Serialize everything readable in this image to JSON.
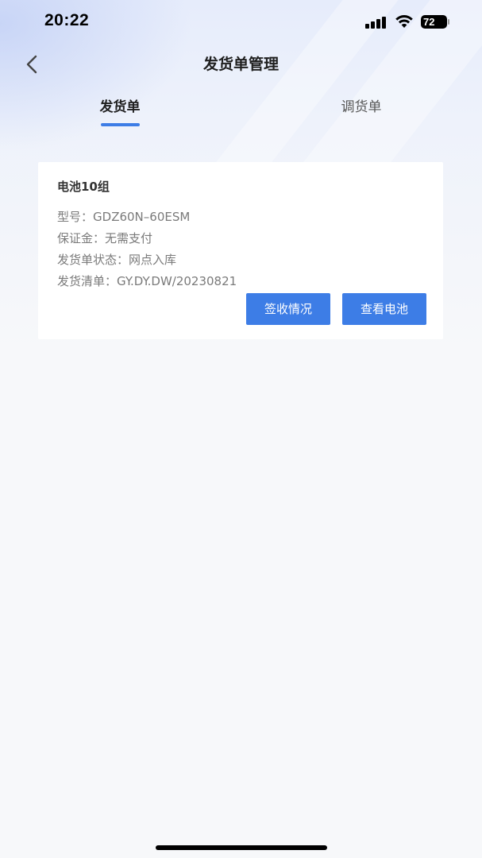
{
  "status_bar": {
    "time": "20:22",
    "battery": "72"
  },
  "header": {
    "title": "发货单管理"
  },
  "tabs": [
    {
      "label": "发货单",
      "active": true
    },
    {
      "label": "调货单",
      "active": false
    }
  ],
  "card": {
    "title": "电池10组",
    "rows": [
      {
        "label": "型号：",
        "value": "GDZ60N–60ESM"
      },
      {
        "label": "保证金：",
        "value": "无需支付"
      },
      {
        "label": "发货单状态：",
        "value": "网点入库"
      },
      {
        "label": "发货清单：",
        "value": "GY.DY.DW/20230821"
      }
    ],
    "buttons": {
      "sign": "签收情况",
      "view": "查看电池"
    }
  },
  "colors": {
    "accent": "#3d7de6",
    "background": "#f7f8fa"
  }
}
